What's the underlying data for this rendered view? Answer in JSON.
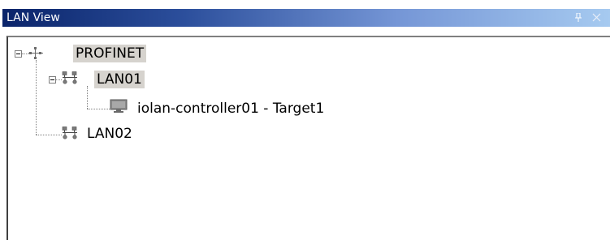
{
  "window": {
    "title": "LAN View",
    "pin_icon": "pin-icon",
    "close_icon": "close-icon"
  },
  "colors": {
    "title_gradient_start": "#0a246a",
    "title_gradient_end": "#a6caf0",
    "selection_bg": "#d6d3ce"
  },
  "tree": {
    "root": {
      "label": "PROFINET",
      "icon": "network-root-icon",
      "expanded": true,
      "highlighted": true
    },
    "lan01": {
      "label": "LAN01",
      "icon": "lan-network-icon",
      "expanded": true,
      "highlighted": true
    },
    "controller": {
      "label": "iolan-controller01 - Target1",
      "icon": "monitor-icon"
    },
    "lan02": {
      "label": "LAN02",
      "icon": "lan-network-icon"
    }
  }
}
